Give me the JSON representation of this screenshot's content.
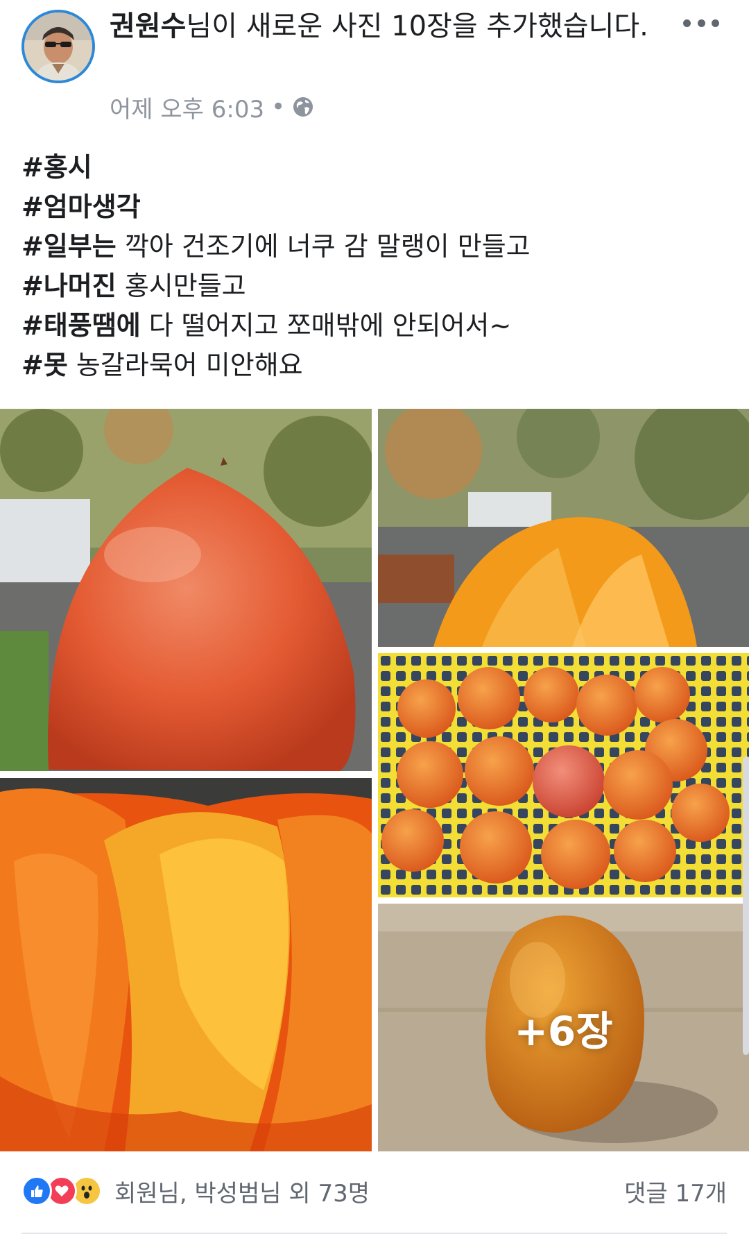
{
  "post": {
    "author": "권원수",
    "action": "님이 새로운 사진 10장을 추가했습니다.",
    "timestamp": "어제 오후 6:03",
    "separator": "•",
    "privacy_icon": "globe-icon",
    "more_icon": "more-dots-icon"
  },
  "body": {
    "lines": [
      {
        "tag": "#홍시",
        "rest": ""
      },
      {
        "tag": "#엄마생각",
        "rest": ""
      },
      {
        "tag": "#일부는",
        "rest": " 깍아 건조기에 너쿠 감 말랭이 만들고"
      },
      {
        "tag": "#나머진",
        "rest": " 홍시만들고"
      },
      {
        "tag": "#태풍땜에",
        "rest": " 다 떨어지고 쪼매밖에 안되어서~"
      },
      {
        "tag": "#못",
        "rest": " 농갈라묵어 미안해요"
      }
    ]
  },
  "photos": {
    "more_label": "+6장"
  },
  "footer": {
    "reaction_icons": [
      "like-icon",
      "love-icon",
      "wow-icon"
    ],
    "reactions_text": "회원님, 박성범님 외 73명",
    "comments_text": "댓글 17개"
  },
  "colors": {
    "avatar_ring": "#2d88d8",
    "like": "#2078f4",
    "love": "#f33e58",
    "wow": "#f7c640",
    "meta_text": "#8d949e"
  }
}
